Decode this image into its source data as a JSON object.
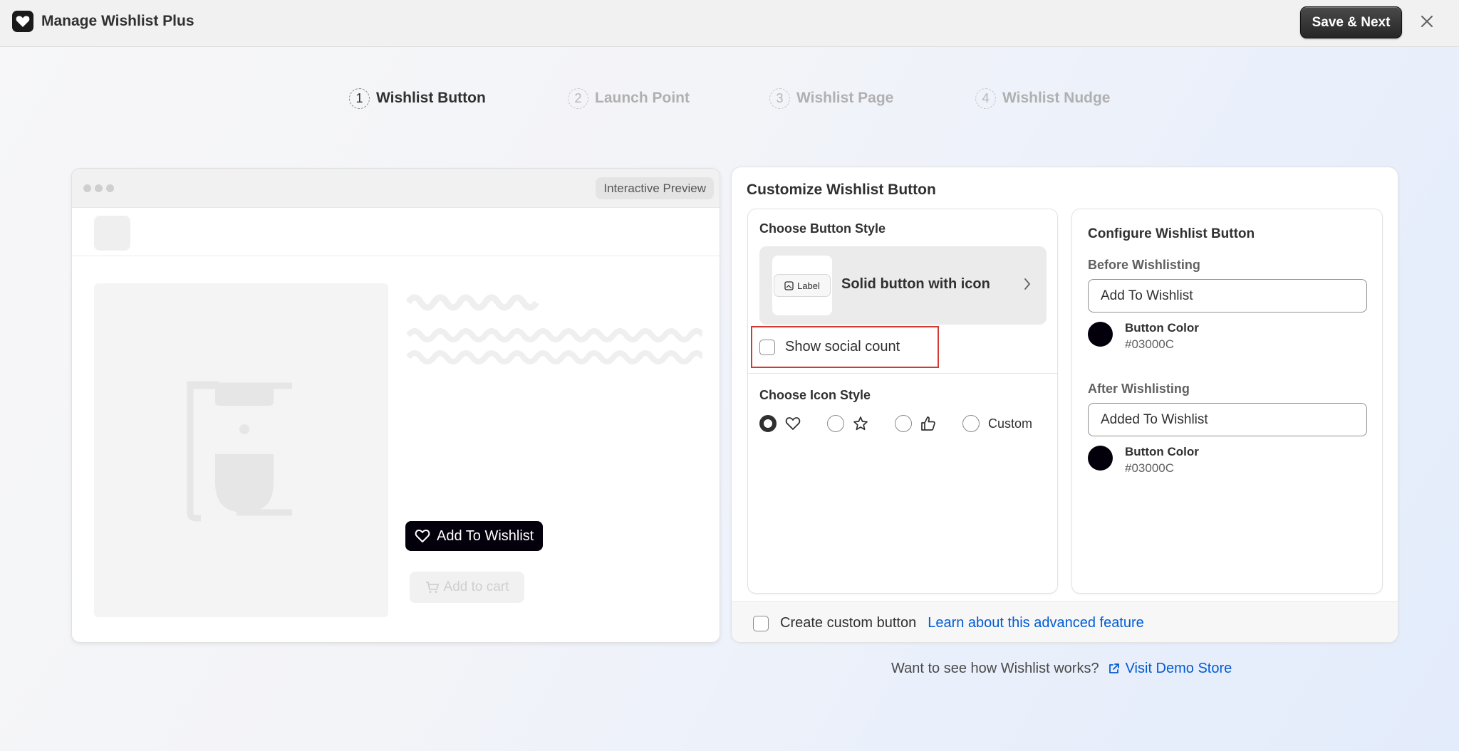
{
  "app": {
    "title": "Manage Wishlist Plus",
    "save_label": "Save & Next"
  },
  "steps": [
    {
      "num": "1",
      "label": "Wishlist Button",
      "active": true
    },
    {
      "num": "2",
      "label": "Launch Point",
      "active": false
    },
    {
      "num": "3",
      "label": "Wishlist Page",
      "active": false
    },
    {
      "num": "4",
      "label": "Wishlist Nudge",
      "active": false
    }
  ],
  "preview": {
    "badge": "Interactive Preview",
    "wishlist_button": "Add To Wishlist",
    "cart_button": "Add to cart"
  },
  "customize": {
    "title": "Customize Wishlist Button",
    "button_style": {
      "heading": "Choose Button Style",
      "thumb_label": "Label",
      "selected": "Solid button with icon"
    },
    "social_count_label": "Show social count",
    "icon_style": {
      "heading": "Choose Icon Style",
      "options": [
        "heart-icon",
        "star-icon",
        "thumbs-up-icon",
        "Custom"
      ],
      "selected_index": 0
    },
    "configure": {
      "heading": "Configure Wishlist Button",
      "before": {
        "label": "Before Wishlisting",
        "value": "Add To Wishlist",
        "color_label": "Button Color",
        "color": "#03000C"
      },
      "after": {
        "label": "After Wishlisting",
        "value": "Added To Wishlist",
        "color_label": "Button Color",
        "color": "#03000C"
      }
    },
    "custom_button": {
      "label": "Create custom button",
      "link": "Learn about this advanced feature"
    }
  },
  "footer": {
    "question": "Want to see how Wishlist works?",
    "link": "Visit Demo Store"
  }
}
